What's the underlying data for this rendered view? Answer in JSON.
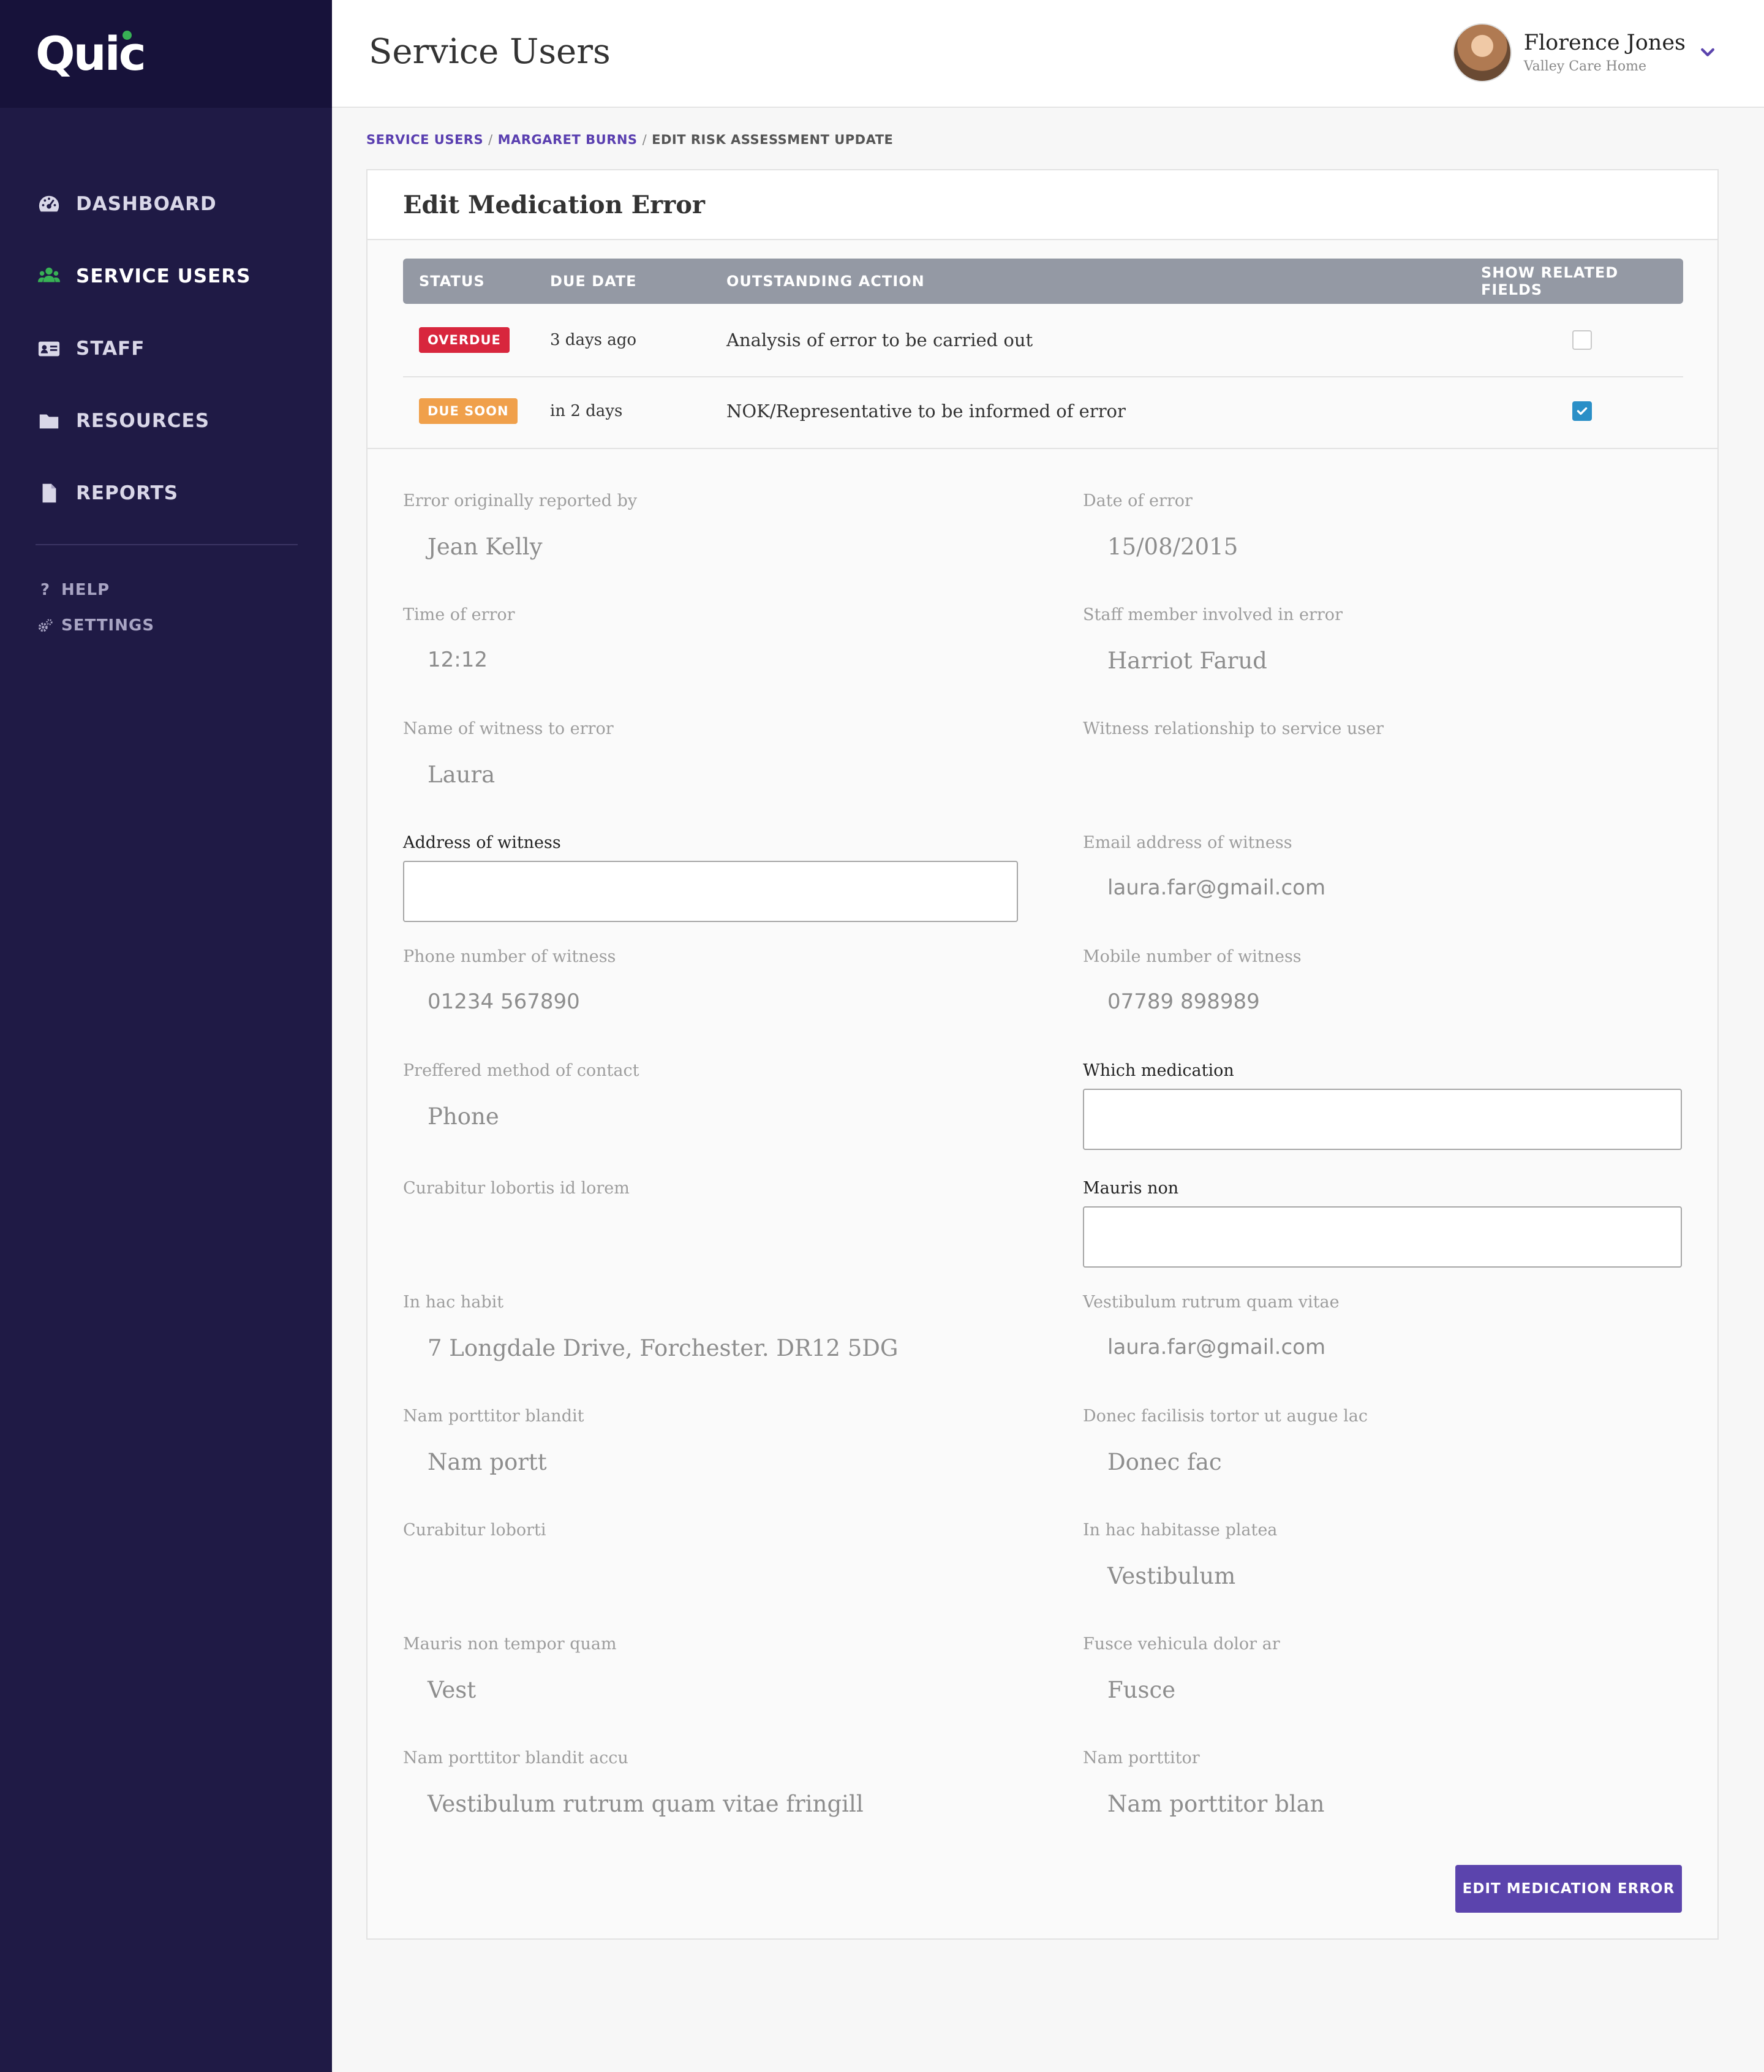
{
  "app": {
    "logo_text": "Quic",
    "accent_color": "#5b44ad",
    "sidebar_color": "#1f1a45",
    "brand_dot_color": "#38b255"
  },
  "sidebar": {
    "items": [
      {
        "label": "DASHBOARD",
        "icon": "dashboard-icon",
        "active": false
      },
      {
        "label": "SERVICE USERS",
        "icon": "users-icon",
        "active": true
      },
      {
        "label": "STAFF",
        "icon": "id-card-icon",
        "active": false
      },
      {
        "label": "RESOURCES",
        "icon": "folder-icon",
        "active": false
      },
      {
        "label": "REPORTS",
        "icon": "file-icon",
        "active": false
      }
    ],
    "secondary": [
      {
        "label": "HELP",
        "icon": "question-icon"
      },
      {
        "label": "SETTINGS",
        "icon": "gears-icon"
      }
    ]
  },
  "header": {
    "title": "Service Users",
    "user": {
      "name": "Florence Jones",
      "org": "Valley Care Home"
    }
  },
  "breadcrumb": [
    {
      "label": "SERVICE USERS"
    },
    {
      "label": "MARGARET BURNS"
    },
    {
      "label": "EDIT RISK ASSESSMENT UPDATE"
    }
  ],
  "card": {
    "title": "Edit Medication Error",
    "table": {
      "headers": {
        "status": "STATUS",
        "due": "DUE DATE",
        "action": "OUTSTANDING ACTION",
        "show": "SHOW RELATED FIELDS"
      },
      "rows": [
        {
          "status": "OVERDUE",
          "status_color": "#d8263d",
          "due": "3 days ago",
          "action": "Analysis of error to be carried out",
          "checked": false
        },
        {
          "status": "DUE SOON",
          "status_color": "#f0a04b",
          "due": "in 2 days",
          "action": "NOK/Representative to be informed of error",
          "checked": true
        }
      ]
    },
    "fields": {
      "reported_by": {
        "label": "Error originally reported by",
        "value": "Jean Kelly"
      },
      "date_of_error": {
        "label": "Date of error",
        "value": "15/08/2015"
      },
      "time_of_error": {
        "label": "Time of error",
        "value": "12:12"
      },
      "staff_member": {
        "label": "Staff member involved in error",
        "value": "Harriot Farud"
      },
      "witness_name": {
        "label": "Name of witness to error",
        "value": "Laura"
      },
      "witness_relationship": {
        "label": "Witness relationship to service user",
        "value": ""
      },
      "witness_address": {
        "label": "Address of witness",
        "value": ""
      },
      "witness_email": {
        "label": "Email address of witness",
        "value": "laura.far@gmail.com"
      },
      "witness_phone": {
        "label": "Phone number of witness",
        "value": "01234 567890"
      },
      "witness_mobile": {
        "label": "Mobile number of witness",
        "value": "07789 898989"
      },
      "preferred_contact": {
        "label": "Preffered method of contact",
        "value": "Phone"
      },
      "which_medication": {
        "label": "Which medication",
        "value": ""
      },
      "curabitur_lobortis": {
        "label": "Curabitur lobortis id lorem",
        "value": ""
      },
      "mauris_non": {
        "label": "Mauris non",
        "value": ""
      },
      "in_hac_habit": {
        "label": "In hac habit",
        "value": "7 Longdale Drive, Forchester. DR12 5DG"
      },
      "vestibulum_rutrum": {
        "label": "Vestibulum rutrum quam vitae",
        "value": "laura.far@gmail.com"
      },
      "nam_porttitor_blandit": {
        "label": "Nam porttitor blandit",
        "value": "Nam portt"
      },
      "donec_facilisis": {
        "label": "Donec facilisis tortor ut augue lac",
        "value": "Donec fac"
      },
      "curabitur_loborti": {
        "label": "Curabitur loborti",
        "value": ""
      },
      "in_hac_habitasse": {
        "label": "In hac habitasse platea",
        "value": "Vestibulum"
      },
      "mauris_tempor": {
        "label": "Mauris non tempor quam",
        "value": "Vest"
      },
      "fusce_vehicula": {
        "label": "Fusce vehicula dolor ar",
        "value": "Fusce"
      },
      "nam_blandit_accu": {
        "label": "Nam porttitor blandit accu",
        "value": "Vestibulum rutrum quam vitae fringill"
      },
      "nam_porttitor": {
        "label": "Nam porttitor",
        "value": "Nam porttitor blan"
      }
    },
    "submit_label": "EDIT MEDICATION ERROR"
  }
}
